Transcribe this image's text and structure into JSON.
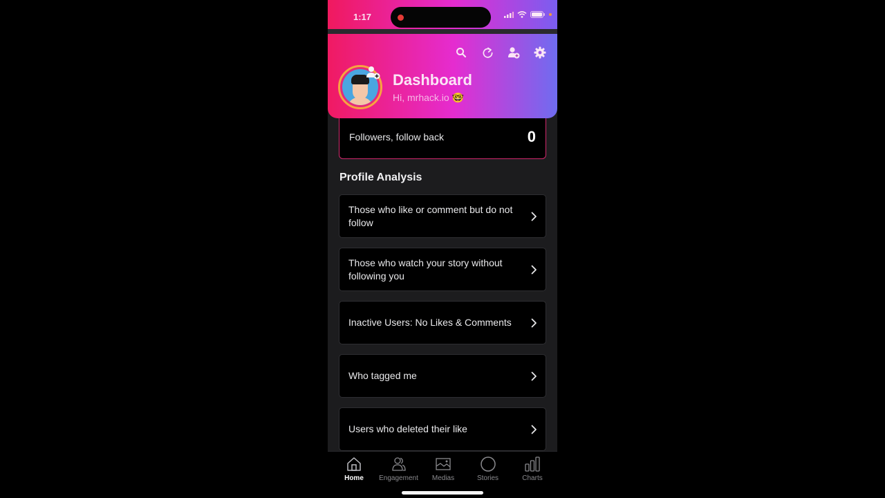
{
  "status_bar": {
    "time": "1:17"
  },
  "header": {
    "title": "Dashboard",
    "greeting": "Hi,  mrhack.io 🤓",
    "icons": [
      "search-icon",
      "refresh-icon",
      "add-user-icon",
      "gear-icon"
    ]
  },
  "follow_card": {
    "label": "Followers, follow back",
    "count": "0"
  },
  "section": {
    "title": "Profile Analysis"
  },
  "items": [
    {
      "label": "Those who like or comment but do not follow"
    },
    {
      "label": "Those who watch your story without following you"
    },
    {
      "label": "Inactive Users: No Likes & Comments"
    },
    {
      "label": "Who tagged me"
    },
    {
      "label": "Users who deleted their like"
    }
  ],
  "tabs": [
    {
      "label": "Home",
      "icon": "home-icon",
      "active": true
    },
    {
      "label": "Engagement",
      "icon": "users-icon",
      "active": false
    },
    {
      "label": "Medias",
      "icon": "image-icon",
      "active": false
    },
    {
      "label": "Stories",
      "icon": "circle-icon",
      "active": false
    },
    {
      "label": "Charts",
      "icon": "bar-chart-icon",
      "active": false
    }
  ],
  "colors": {
    "accent_pink": "#f01a62",
    "accent_magenta": "#e52cd0",
    "accent_blue": "#6f6cf0",
    "card_border": "#d2286c"
  }
}
